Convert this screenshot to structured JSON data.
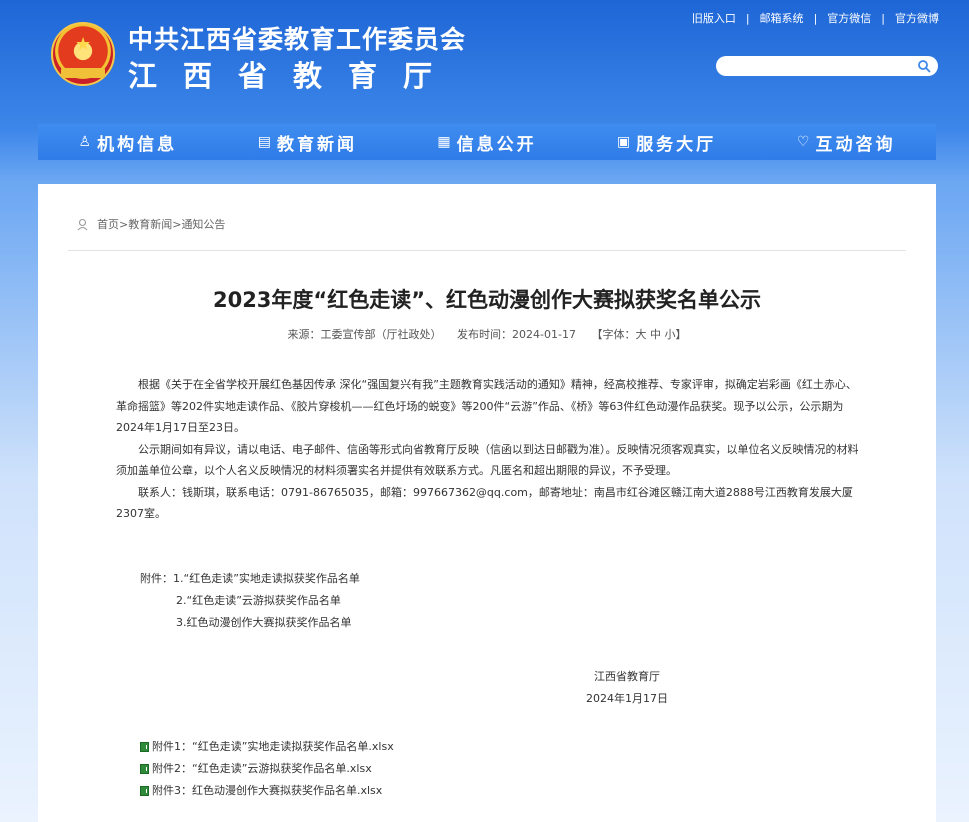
{
  "header": {
    "org_title": "中共江西省委教育工作委员会",
    "dept_title": "江西省教育厅",
    "top_links": [
      "旧版入口",
      "邮箱系统",
      "官方微信",
      "官方微博"
    ],
    "search_placeholder": ""
  },
  "nav": {
    "items": [
      {
        "label": "机构信息",
        "icon": "org-icon",
        "glyph": "♙"
      },
      {
        "label": "教育新闻",
        "icon": "news-icon",
        "glyph": "▤"
      },
      {
        "label": "信息公开",
        "icon": "info-icon",
        "glyph": "▦"
      },
      {
        "label": "服务大厅",
        "icon": "service-icon",
        "glyph": "▣"
      },
      {
        "label": "互动咨询",
        "icon": "chat-icon",
        "glyph": "♡"
      }
    ]
  },
  "breadcrumb": {
    "home": "首页",
    "sep1": ">",
    "section": "教育新闻",
    "sep2": ">",
    "page": "通知公告"
  },
  "article": {
    "title": "2023年度“红色走读”、红色动漫创作大赛拟获奖名单公示",
    "source": "来源：工委宣传部（厅社政处）",
    "published": "发布时间：2024-01-17",
    "font_size_control": "【字体：大 中 小】",
    "paragraphs": [
      "根据《关于在全省学校开展红色基因传承 深化“强国复兴有我”主题教育实践活动的通知》精神，经高校推荐、专家评审，拟确定岩彩画《红土赤心、革命摇篮》等202件实地走读作品、《胶片穿梭机——红色圩场的蜕变》等200件“云游”作品、《桥》等63件红色动漫作品获奖。现予以公示，公示期为2024年1月17日至23日。",
      "公示期间如有异议，请以电话、电子邮件、信函等形式向省教育厅反映（信函以到达日邮戳为准）。反映情况须客观真实，以单位名义反映情况的材料须加盖单位公章，以个人名义反映情况的材料须署实名并提供有效联系方式。凡匿名和超出期限的异议，不予受理。",
      "联系人：钱斯琪，联系电话：0791-86765035，邮箱：997667362@qq.com，邮寄地址：南昌市红谷滩区赣江南大道2888号江西教育发展大厦2307室。"
    ],
    "attachments": [
      "附件：1.“红色走读”实地走读拟获奖作品名单",
      "2.“红色走读”云游拟获奖作品名单",
      "3.红色动漫创作大赛拟获奖作品名单"
    ],
    "signature_org": "江西省教育厅",
    "signature_date": "2024年1月17日",
    "files": [
      "附件1：“红色走读”实地走读拟获奖作品名单.xlsx",
      "附件2：“红色走读”云游拟获奖作品名单.xlsx",
      "附件3：红色动漫创作大赛拟获奖作品名单.xlsx"
    ]
  },
  "colors": {
    "header_blue": "#1e66d6",
    "nav_blue": "#3f8df0",
    "file_icon_green": "#2e8b3a"
  }
}
